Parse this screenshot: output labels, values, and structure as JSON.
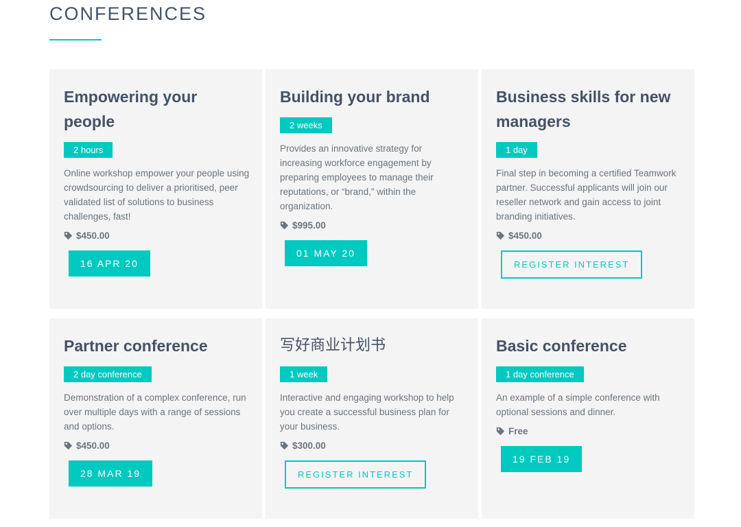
{
  "page": {
    "section_title": "CONFERENCES",
    "accent_color": "#00c9c0",
    "text_color": "#445266"
  },
  "cards": [
    {
      "title": "Empowering your people",
      "duration": "2 hours",
      "description": "Online workshop empower your people using crowdsourcing to deliver a prioritised, peer validated list of solutions to business challenges, fast!",
      "price": "$450.00",
      "action_type": "date",
      "action_label": "16 APR 20",
      "icon": "tag-icon"
    },
    {
      "title": "Building your brand",
      "duration": "2 weeks",
      "description": "Provides an innovative strategy for increasing workforce engagement by preparing employees to manage their reputations, or “brand,” within the organization.",
      "price": "$995.00",
      "action_type": "date",
      "action_label": "01 MAY 20",
      "icon": "tag-icon"
    },
    {
      "title": "Business skills for new managers",
      "duration": "1 day",
      "description": "Final step in becoming a certified Teamwork partner. Successful applicants will join our reseller network and gain access to joint branding initiatives.",
      "price": "$450.00",
      "action_type": "register",
      "action_label": "REGISTER INTEREST",
      "icon": "tag-icon"
    },
    {
      "title": "Partner conference",
      "duration": "2 day conference",
      "description": "Demonstration of a complex conference, run over multiple days with a range of sessions and options.",
      "price": "$450.00",
      "action_type": "date",
      "action_label": "28 MAR 19",
      "icon": "tag-icon"
    },
    {
      "title": "写好商业计划书",
      "duration": "1 week",
      "description": "Interactive and engaging workshop to help you create a successful business plan for your business.",
      "price": "$300.00",
      "action_type": "register",
      "action_label": "REGISTER INTEREST",
      "icon": "tag-icon"
    },
    {
      "title": "Basic conference",
      "duration": "1 day conference",
      "description": "An example of a simple conference with optional sessions and dinner.",
      "price": "Free",
      "action_type": "date",
      "action_label": "19 FEB 19",
      "icon": "tag-icon"
    }
  ]
}
